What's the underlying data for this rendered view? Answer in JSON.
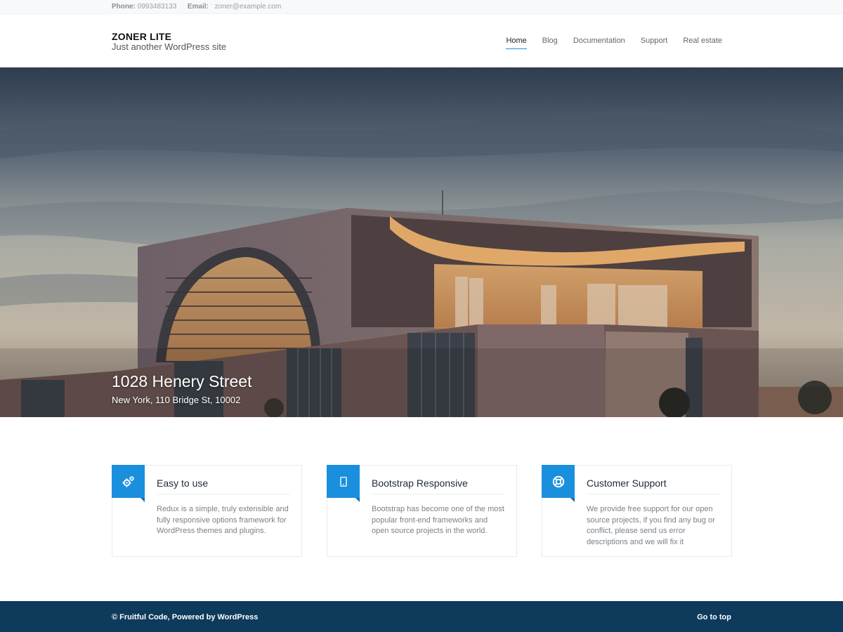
{
  "topbar": {
    "phone_label": "Phone:",
    "phone": "0993483133",
    "email_label": "Email:",
    "email": "zoner@example.com"
  },
  "header": {
    "site_title": "ZONER LITE",
    "tagline": "Just another WordPress site"
  },
  "nav": {
    "items": [
      {
        "label": "Home",
        "active": true
      },
      {
        "label": "Blog"
      },
      {
        "label": "Documentation"
      },
      {
        "label": "Support"
      },
      {
        "label": "Real estate"
      }
    ]
  },
  "hero": {
    "title": "1028 Henery Street",
    "subtitle": "New York, 110 Bridge St, 10002"
  },
  "features": [
    {
      "icon": "gears-icon",
      "title": "Easy to use",
      "text": "Redux is a simple, truly extensible and fully responsive options framework for WordPress themes and plugins."
    },
    {
      "icon": "mobile-icon",
      "title": "Bootstrap Responsive",
      "text": "Bootstrap has become one of the most popular front-end frameworks and open source projects in the world."
    },
    {
      "icon": "lifebuoy-icon",
      "title": "Customer Support",
      "text": "We provide free support for our open source projects, if you find any bug or conflict, please send us error descriptions and we will fix it"
    }
  ],
  "footer": {
    "copyright": "© Fruitful Code, Powered by WordPress",
    "go_top": "Go to top"
  },
  "colors": {
    "accent": "#1a8fdd",
    "footer_bg": "#0e3a5c"
  }
}
